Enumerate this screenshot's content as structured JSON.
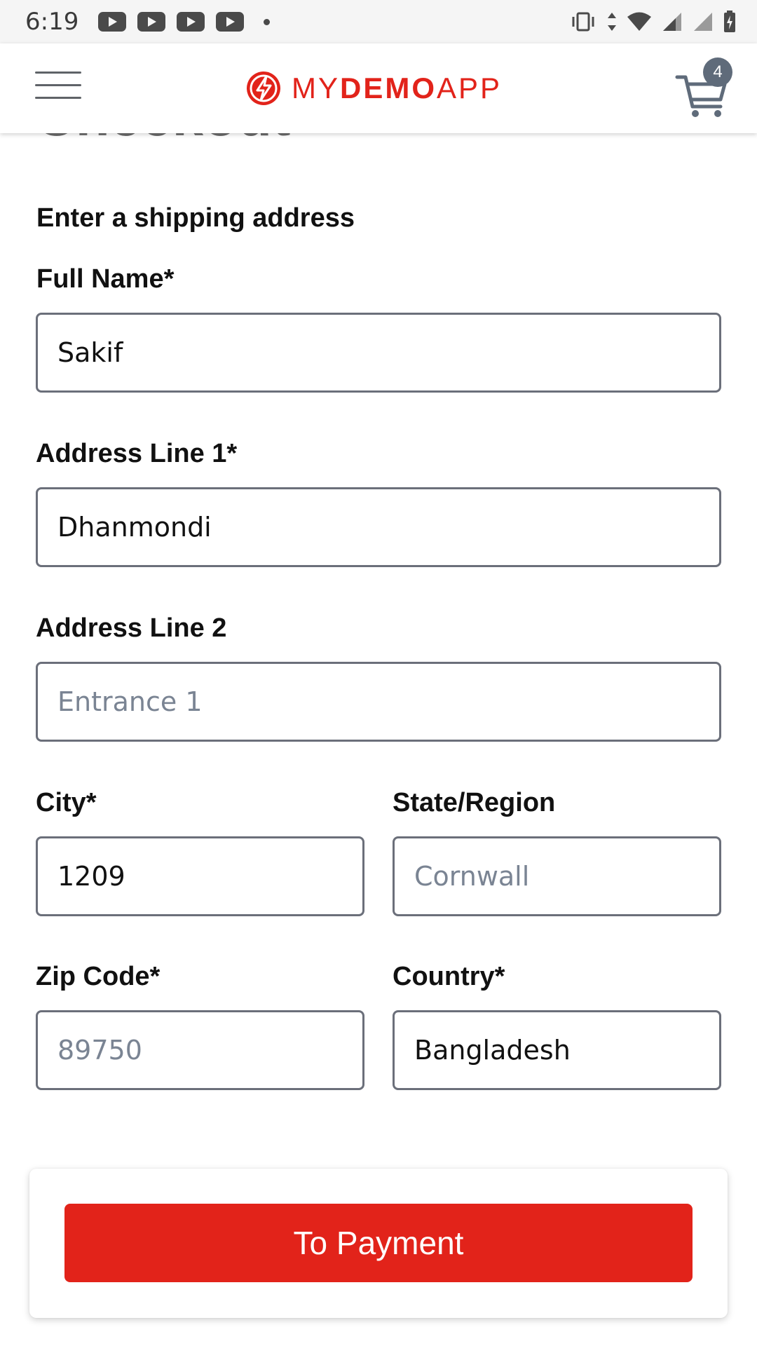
{
  "status_bar": {
    "time": "6:19",
    "notification_icons": [
      "youtube-icon",
      "youtube-icon",
      "youtube-icon",
      "youtube-icon"
    ],
    "system_icons": [
      "vibrate-icon",
      "data-arrows-icon",
      "wifi-icon",
      "signal-icon",
      "signal-icon",
      "battery-charging-icon"
    ]
  },
  "header": {
    "brand_prefix": "MY",
    "brand_bold": "DEMO",
    "brand_suffix": "APP",
    "cart_count": "4",
    "brand_color": "#e2231a"
  },
  "page": {
    "title": "Checkout",
    "section_title": "Enter a shipping address"
  },
  "form": {
    "full_name": {
      "label": "Full Name*",
      "value": "Sakif",
      "placeholder": ""
    },
    "address1": {
      "label": "Address Line 1*",
      "value": "Dhanmondi",
      "placeholder": ""
    },
    "address2": {
      "label": "Address Line 2",
      "value": "",
      "placeholder": "Entrance 1"
    },
    "city": {
      "label": "City*",
      "value": "1209",
      "placeholder": ""
    },
    "state": {
      "label": "State/Region",
      "value": "",
      "placeholder": "Cornwall"
    },
    "zip": {
      "label": "Zip Code*",
      "value": "",
      "placeholder": "89750"
    },
    "country": {
      "label": "Country*",
      "value": "Bangladesh",
      "placeholder": ""
    }
  },
  "actions": {
    "to_payment": "To Payment"
  }
}
